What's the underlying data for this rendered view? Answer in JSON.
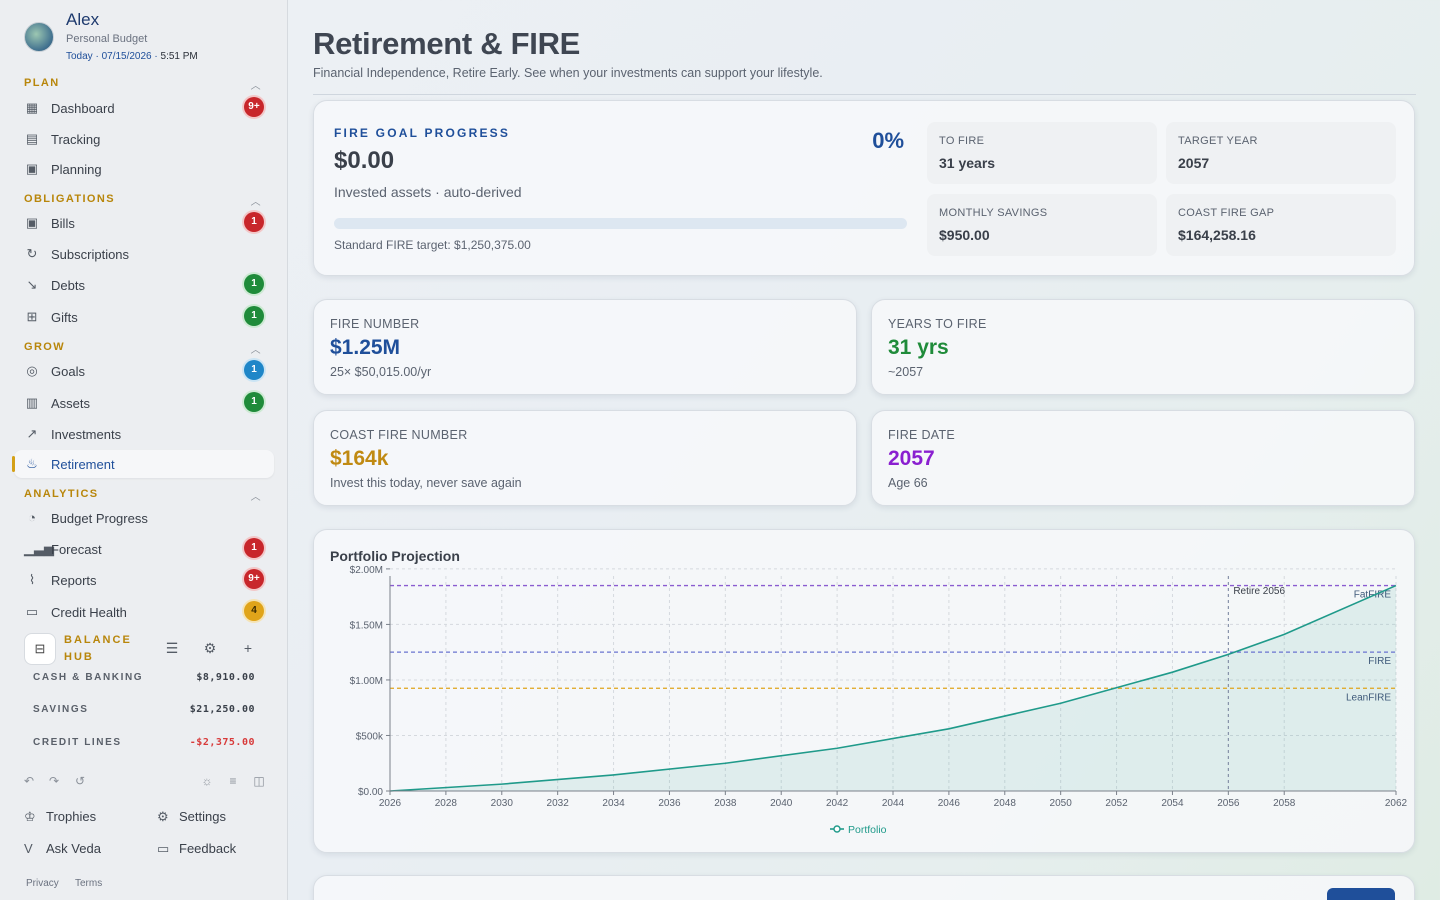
{
  "user": {
    "name": "Alex",
    "subtitle": "Personal Budget",
    "date_prefix": "Today · 07/15/2026 ·",
    "time": "5:51 PM"
  },
  "sections": {
    "plan": "PLAN",
    "obligations": "OBLIGATIONS",
    "grow": "GROW",
    "analytics": "ANALYTICS"
  },
  "nav": {
    "dashboard": {
      "label": "Dashboard",
      "badge": "9+"
    },
    "tracking": {
      "label": "Tracking"
    },
    "planning": {
      "label": "Planning"
    },
    "bills": {
      "label": "Bills",
      "badge": "1"
    },
    "subscriptions": {
      "label": "Subscriptions"
    },
    "debts": {
      "label": "Debts",
      "badge": "1"
    },
    "gifts": {
      "label": "Gifts",
      "badge": "1"
    },
    "goals": {
      "label": "Goals",
      "badge": "1"
    },
    "assets": {
      "label": "Assets",
      "badge": "1"
    },
    "investments": {
      "label": "Investments"
    },
    "retirement": {
      "label": "Retirement"
    },
    "budget_progress": {
      "label": "Budget Progress"
    },
    "forecast": {
      "label": "Forecast",
      "badge": "1"
    },
    "reports": {
      "label": "Reports",
      "badge": "9+"
    },
    "credit_health": {
      "label": "Credit Health",
      "badge": "4"
    }
  },
  "balance_hub": {
    "title": "BALANCE HUB",
    "rows": [
      {
        "label": "CASH & BANKING",
        "value": "$8,910.00"
      },
      {
        "label": "SAVINGS",
        "value": "$21,250.00"
      },
      {
        "label": "CREDIT LINES",
        "value": "-$2,375.00"
      }
    ]
  },
  "footer": {
    "trophies": "Trophies",
    "settings": "Settings",
    "ask": "Ask Veda",
    "feedback": "Feedback",
    "privacy": "Privacy",
    "terms": "Terms"
  },
  "page": {
    "title": "Retirement & FIRE",
    "subtitle": "Financial Independence, Retire Early. See when your investments can support your lifestyle."
  },
  "goal": {
    "label": "FIRE GOAL PROGRESS",
    "value": "$0.00",
    "sub": "Invested assets · auto-derived",
    "percent": "0%",
    "progress_fraction": 0,
    "target": "Standard FIRE target: $1,250,375.00",
    "minis": [
      {
        "label": "TO FIRE",
        "value": "31 years"
      },
      {
        "label": "TARGET YEAR",
        "value": "2057"
      },
      {
        "label": "MONTHLY SAVINGS",
        "value": "$950.00"
      },
      {
        "label": "COAST FIRE GAP",
        "value": "$164,258.16"
      }
    ]
  },
  "stats": [
    {
      "label": "FIRE NUMBER",
      "value": "$1.25M",
      "sub": "25× $50,015.00/yr",
      "color": "#1f4f9a"
    },
    {
      "label": "YEARS TO FIRE",
      "value": "31 yrs",
      "sub": "~2057",
      "color": "#1f8b3a"
    },
    {
      "label": "COAST FIRE NUMBER",
      "value": "$164k",
      "sub": "Invest this today, never save again",
      "color": "#c08a12"
    },
    {
      "label": "FIRE DATE",
      "value": "2057",
      "sub": "Age 66",
      "color": "#8a1fd0"
    }
  ],
  "chart_data": {
    "type": "area",
    "title": "Portfolio Projection",
    "x_ticks": [
      2026,
      2028,
      2030,
      2032,
      2034,
      2036,
      2038,
      2040,
      2042,
      2044,
      2046,
      2048,
      2050,
      2052,
      2054,
      2056,
      2058,
      2062
    ],
    "y_ticks": [
      {
        "value": 0,
        "label": "$0.00"
      },
      {
        "value": 500000,
        "label": "$500k"
      },
      {
        "value": 1000000,
        "label": "$1.00M"
      },
      {
        "value": 1500000,
        "label": "$1.50M"
      },
      {
        "value": 2000000,
        "label": "$2.00M"
      }
    ],
    "xlim": [
      2026,
      2062
    ],
    "ylim": [
      0,
      1900000
    ],
    "grid": true,
    "series": [
      {
        "name": "Portfolio",
        "color": "#1f9a8a",
        "x": [
          2026,
          2030,
          2034,
          2038,
          2042,
          2046,
          2050,
          2054,
          2056,
          2058,
          2062
        ],
        "y": [
          0,
          62000,
          145000,
          250000,
          385000,
          560000,
          790000,
          1070000,
          1230000,
          1410000,
          1850000
        ]
      }
    ],
    "reference_lines": [
      {
        "label": "FatFIRE",
        "value": 1850000,
        "color": "#8a5cd0"
      },
      {
        "label": "FIRE",
        "value": 1250375,
        "color": "#6a74d0"
      },
      {
        "label": "LeanFIRE",
        "value": 925000,
        "color": "#e0a41a"
      }
    ],
    "vertical_marker": {
      "label": "Retire 2056",
      "x": 2056
    },
    "legend": {
      "position": "bottom",
      "label": "Portfolio"
    }
  }
}
